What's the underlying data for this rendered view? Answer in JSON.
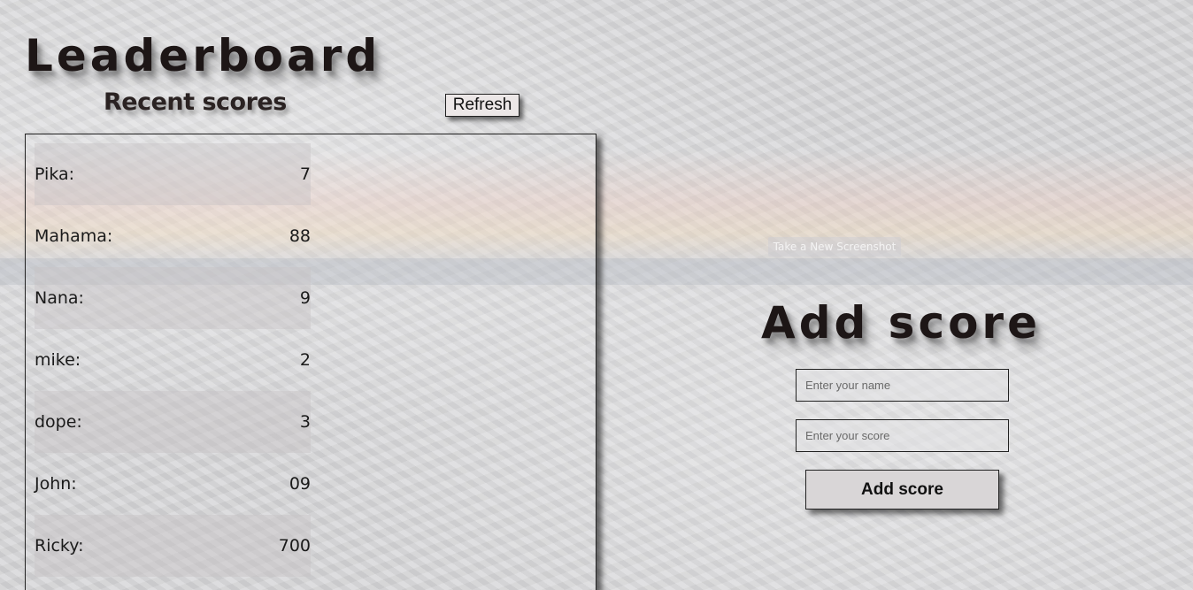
{
  "leaderboard": {
    "title": "Leaderboard",
    "subtitle": "Recent scores",
    "refresh_label": "Refresh",
    "scores": [
      {
        "name": "Pika:",
        "score": "7"
      },
      {
        "name": "Mahama:",
        "score": "88"
      },
      {
        "name": "Nana:",
        "score": "9"
      },
      {
        "name": "mike:",
        "score": "2"
      },
      {
        "name": "dope:",
        "score": "3"
      },
      {
        "name": "John:",
        "score": "09"
      },
      {
        "name": "Ricky:",
        "score": "700"
      }
    ]
  },
  "overlay": {
    "new_screenshot_label": "Take a New Screenshot"
  },
  "add_score": {
    "title": "Add score",
    "name_placeholder": "Enter your name",
    "score_placeholder": "Enter your score",
    "submit_label": "Add score"
  },
  "colors": {
    "background": "#d6d6d8",
    "text": "#1d1616",
    "border": "#222222"
  }
}
